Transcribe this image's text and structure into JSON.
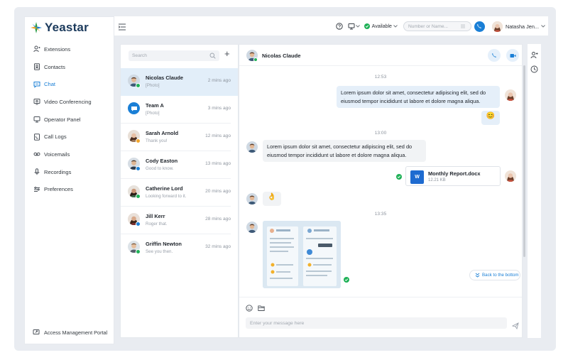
{
  "brand": {
    "name": "Yeastar"
  },
  "sidebar": {
    "items": [
      {
        "label": "Extensions",
        "icon": "extensions-icon",
        "active": false
      },
      {
        "label": "Contacts",
        "icon": "contacts-icon",
        "active": false
      },
      {
        "label": "Chat",
        "icon": "chat-icon",
        "active": true
      },
      {
        "label": "Video Conferencing",
        "icon": "video-conferencing-icon",
        "active": false
      },
      {
        "label": "Operator Panel",
        "icon": "operator-panel-icon",
        "active": false
      },
      {
        "label": "Call Logs",
        "icon": "call-logs-icon",
        "active": false
      },
      {
        "label": "Voicemails",
        "icon": "voicemail-icon",
        "active": false
      },
      {
        "label": "Recordings",
        "icon": "recordings-icon",
        "active": false
      },
      {
        "label": "Preferences",
        "icon": "preferences-icon",
        "active": false
      }
    ],
    "portal_label": "Access Management Portal"
  },
  "topbar": {
    "status_label": "Available",
    "dial_placeholder": "Number or Name...",
    "user_name": "Natasha Jen..."
  },
  "conversations": {
    "search_placeholder": "Search",
    "items": [
      {
        "name": "Nicolas Claude",
        "preview": "[Photo]",
        "time": "2 mins ago",
        "active": true
      },
      {
        "name": "Team A",
        "preview": "[Photo]",
        "time": "3 mins ago",
        "active": false
      },
      {
        "name": "Sarah Arnold",
        "preview": "Thank you!",
        "time": "12 mins ago",
        "active": false
      },
      {
        "name": "Cody Easton",
        "preview": "Good to know.",
        "time": "13 mins ago",
        "active": false
      },
      {
        "name": "Catherine Lord",
        "preview": "Looking forward to it.",
        "time": "20 mins ago",
        "active": false
      },
      {
        "name": "Jill Kerr",
        "preview": "Roger that.",
        "time": "28 mins ago",
        "active": false
      },
      {
        "name": "Griffin Newton",
        "preview": "See you then.",
        "time": "32 mins ago",
        "active": false
      }
    ]
  },
  "chat": {
    "contact_name": "Nicolas Claude",
    "timestamps": [
      "12:53",
      "13:00",
      "13:35"
    ],
    "messages": [
      {
        "text": "Lorem ipsum dolor sit amet, consectetur adipiscing elit, sed do eiusmod tempor incididunt ut labore et dolore magna aliqua."
      },
      {
        "text": "Lorem ipsum dolor sit amet, consectetur adipiscing elit, sed do eiusmod tempor incididunt ut labore et dolore magna aliqua."
      }
    ],
    "emoji_reply": "😊",
    "emoji_in": "👌",
    "file": {
      "name": "Monthly Report.docx",
      "size": "12.21 KB",
      "type_letter": "W"
    },
    "back_to_bottom": "Back to the bottom",
    "input_placeholder": "Enter your message here"
  },
  "colors": {
    "accent": "#1a7fd6",
    "online": "#1fb157",
    "bubble_out": "#e5eff9"
  }
}
